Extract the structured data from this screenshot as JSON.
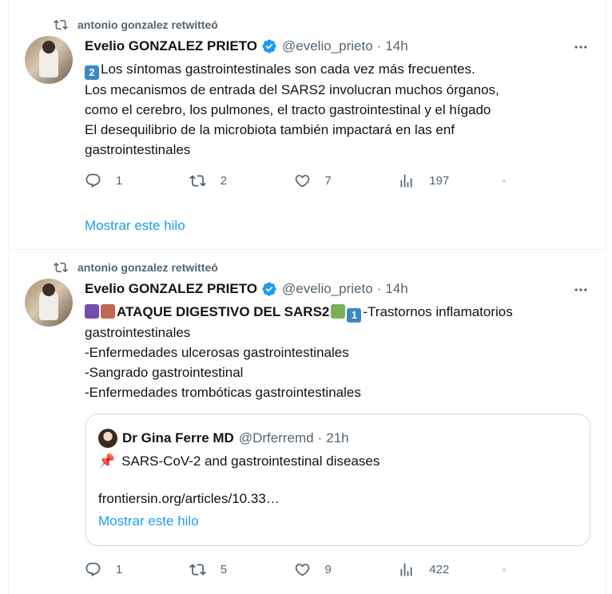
{
  "tweets": [
    {
      "retweeted_by": "antonio gonzalez retwitteó",
      "author_name": "Evelio GONZALEZ PRIETO",
      "handle": "@evelio_prieto",
      "separator": "·",
      "time": "14h",
      "emoji_number": "2",
      "lines": [
        "Los síntomas gastrointestinales son cada vez más frecuentes.",
        "Los mecanismos de entrada del SARS2 involucran muchos órganos,",
        "como el cerebro, los pulmones, el tracto gastrointestinal y el hígado",
        "El desequilibrio de la microbiota también impactará en las enf",
        "gastrointestinales"
      ],
      "stats": {
        "replies": "1",
        "retweets": "2",
        "likes": "7",
        "views": "197"
      },
      "show_thread": "Mostrar este hilo"
    },
    {
      "retweeted_by": "antonio gonzalez retwitteó",
      "author_name": "Evelio GONZALEZ PRIETO",
      "handle": "@evelio_prieto",
      "separator": "·",
      "time": "14h",
      "headline": "ATAQUE DIGESTIVO DEL SARS2",
      "headline_number": "1",
      "headline_rest": "-Trastornos inflamatorios",
      "lines": [
        "gastrointestinales",
        "-Enfermedades ulcerosas gastrointestinales",
        "-Sangrado gastrointestinal",
        "-Enfermedades trombóticas gastrointestinales"
      ],
      "quote": {
        "author_name": "Dr Gina Ferre MD",
        "handle": "@Drferremd",
        "separator": "·",
        "time": "21h",
        "pin": "📌",
        "text": "SARS-CoV-2 and gastrointestinal diseases",
        "link": "frontiersin.org/articles/10.33…",
        "show_thread": "Mostrar este hilo"
      },
      "stats": {
        "replies": "1",
        "retweets": "5",
        "likes": "9",
        "views": "422"
      }
    }
  ],
  "colors": {
    "accent": "#1d9bf0",
    "muted": "#536471",
    "text": "#0f1419",
    "keycap_blue": "#3b88c3",
    "emoji_brown": "#c1694f",
    "emoji_green": "#78b159",
    "emoji_purple": "#744eaa"
  },
  "icons": [
    "retweet-icon",
    "verified-badge-icon",
    "more-icon",
    "reply-icon",
    "like-icon",
    "views-icon",
    "share-icon",
    "thread-spool-icon",
    "pin-icon"
  ]
}
